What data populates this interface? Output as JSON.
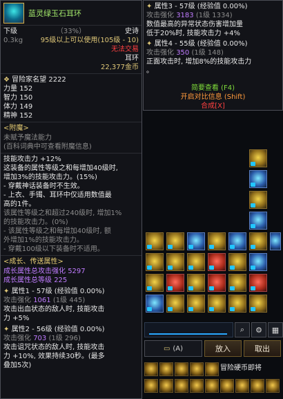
{
  "tooltip": {
    "item_name": "蓝灵绿玉石耳环",
    "grade_row": {
      "left": "下级",
      "mid": "（33%）",
      "right": "史诗"
    },
    "weight": "0.3kg",
    "req": "95级以上可以使用(105级 - 10)",
    "no_trade": "无法交易",
    "slot_type": "耳环",
    "price": "22,377金币",
    "fame": {
      "label": "冒险家名望",
      "value": "2222"
    },
    "stats": [
      {
        "name": "力量",
        "value": "152"
      },
      {
        "name": "智力",
        "value": "150"
      },
      {
        "name": "体力",
        "value": "149"
      },
      {
        "name": "精神",
        "value": "152"
      }
    ],
    "enchant": {
      "title": "<附魔>",
      "line1": "未赋予魔法能力",
      "line2": "(百科词典中可查看附魔信息)"
    },
    "skill_attack": {
      "title": "技能攻击力 +12%",
      "desc": [
        "这装备的属性等级之和每增加40级时,",
        "增加3%的技能攻击力。(15%)",
        "- 穿戴神话装备时不生效。",
        "- 上衣、手镯、耳环中仅适用数值最",
        "高的1件。",
        "该属性等级之和超过240级时, 增加1%",
        "的技能攻击力。(0%)",
        "- 该属性等级之和每增加40级时, 额",
        "外增加1%的技能攻击力。",
        "- 穿戴100级以下装备时不适用。"
      ]
    },
    "growth": {
      "title": "<成长、传送属性>",
      "total_enhance_label": "成长属性总攻击强化",
      "total_enhance_value": "5297",
      "total_level_label": "成长属性总等级",
      "total_level_value": "225",
      "attr1": {
        "header": "属性1 - 57级 (经验值 0.00%)",
        "enh_label": "攻击强化",
        "enh_val": "1061",
        "enh_paren": "(1级 445)",
        "desc": [
          "攻击出血状态的敌人时, 技能攻击",
          "力 +5%"
        ]
      },
      "attr2": {
        "header": "属性2 - 56级 (经验值 0.00%)",
        "enh_label": "攻击强化",
        "enh_val": "703",
        "enh_paren": "(1级 296)",
        "desc": [
          "攻击诅咒状态的敌人时, 技能攻击",
          "力 +10%, 效果持续30秒。(最多",
          "叠加5次)"
        ]
      }
    }
  },
  "compare": {
    "attr3": {
      "header": "属性3 - 57级 (经验值 0.00%)",
      "enh_label": "攻击强化",
      "enh_val": "3183",
      "enh_paren": "(1级 1334)",
      "desc": [
        "数值最高的异常状态伤害增加量",
        "低于20%时, 技能攻击力 +4%"
      ]
    },
    "attr4": {
      "header": "属性4 - 55级 (经验值 0.00%)",
      "enh_label": "攻击强化",
      "enh_val": "350",
      "enh_paren": "(1级 148)",
      "desc": [
        "正面攻击时, 增加8%的技能攻击力",
        "。"
      ]
    },
    "actions": {
      "summary": "简要查看 (F4)",
      "open_compare": "开启对比信息 (Shift)",
      "synthesize": "合成[X]"
    }
  },
  "inventory": {
    "toolbar": {
      "search_icon": "magnifier",
      "settings_icon": "gear",
      "more_icon": "grid"
    },
    "bottom": {
      "mode_label": "(A)",
      "put_label": "放入",
      "take_label": "取出"
    },
    "hotbar_label": "冒险硬币即将"
  }
}
